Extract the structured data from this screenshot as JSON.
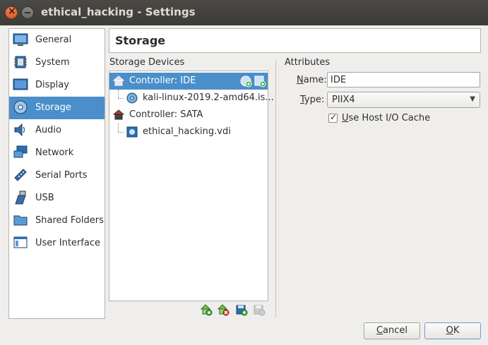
{
  "window": {
    "title": "ethical_hacking - Settings",
    "close_glyph": "×"
  },
  "sidebar": {
    "items": [
      {
        "label": "General",
        "icon": "monitor-icon"
      },
      {
        "label": "System",
        "icon": "chip-icon"
      },
      {
        "label": "Display",
        "icon": "display-icon"
      },
      {
        "label": "Storage",
        "icon": "disk-icon",
        "selected": true
      },
      {
        "label": "Audio",
        "icon": "speaker-icon"
      },
      {
        "label": "Network",
        "icon": "network-icon"
      },
      {
        "label": "Serial Ports",
        "icon": "serial-port-icon"
      },
      {
        "label": "USB",
        "icon": "usb-icon"
      },
      {
        "label": "Shared Folders",
        "icon": "folder-icon"
      },
      {
        "label": "User Interface",
        "icon": "window-icon"
      }
    ]
  },
  "header": {
    "title": "Storage"
  },
  "storage": {
    "label": "Storage Devices",
    "tree": [
      {
        "label": "Controller: IDE",
        "type": "controller",
        "selected": true
      },
      {
        "label": "kali-linux-2019.2-amd64.is...",
        "type": "optical"
      },
      {
        "label": "Controller: SATA",
        "type": "controller"
      },
      {
        "label": "ethical_hacking.vdi",
        "type": "harddisk"
      }
    ]
  },
  "attributes": {
    "label": "Attributes",
    "name_label": "Name:",
    "name_value": "IDE",
    "type_label": "Type:",
    "type_value": "PIIX4",
    "cache_checked": true,
    "cache_label": "Use Host I/O Cache"
  },
  "buttons": {
    "cancel": "Cancel",
    "ok": "OK"
  },
  "colors": {
    "selection": "#4a8fca",
    "titlebar": "#3c3b37",
    "window_bg": "#efeeec"
  }
}
